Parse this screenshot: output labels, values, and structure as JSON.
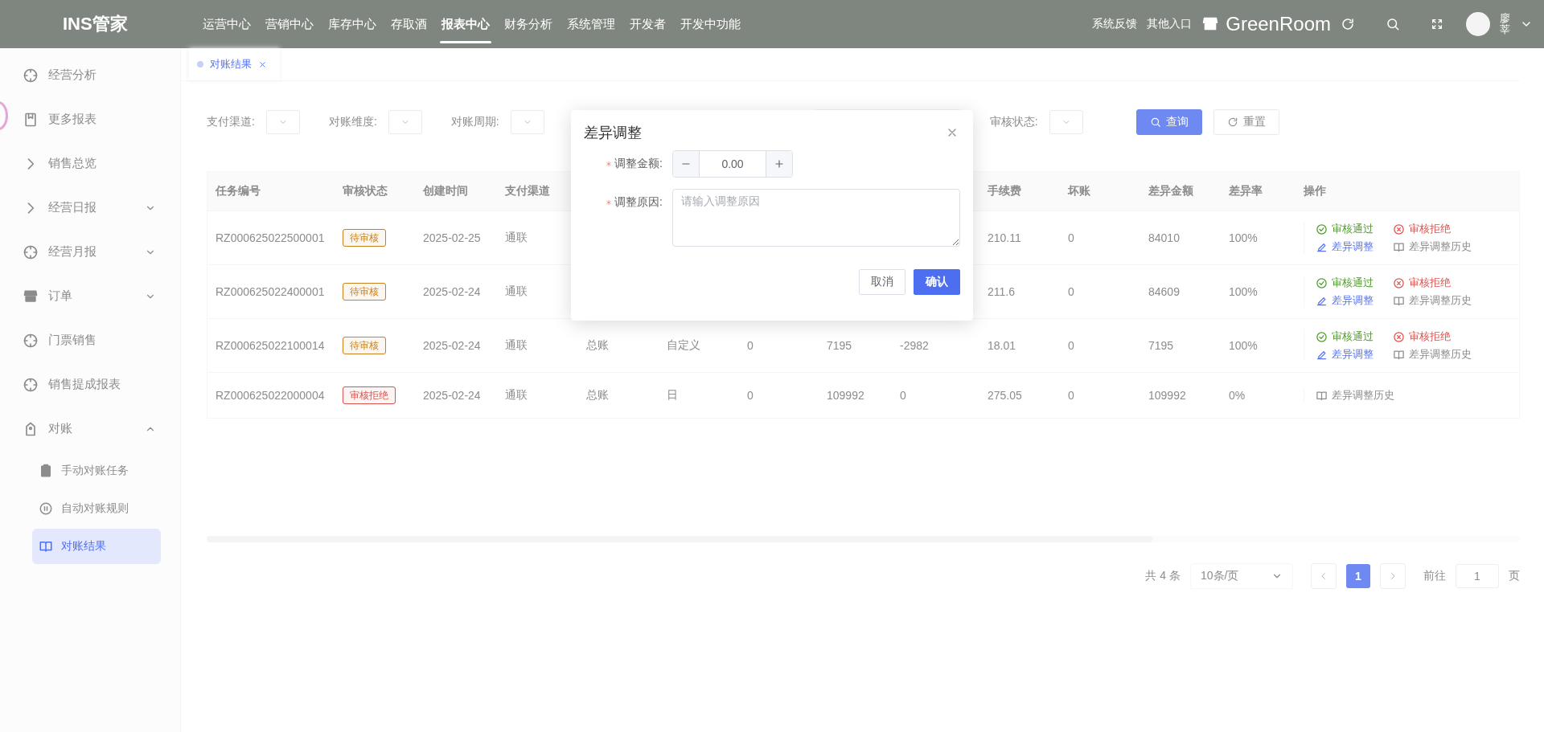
{
  "app": {
    "logo": "INS管家"
  },
  "nav": [
    {
      "label": "运营中心",
      "selected": false
    },
    {
      "label": "营销中心",
      "selected": false
    },
    {
      "label": "库存中心",
      "selected": false
    },
    {
      "label": "存取酒",
      "selected": false
    },
    {
      "label": "报表中心",
      "selected": true
    },
    {
      "label": "财务分析",
      "selected": false
    },
    {
      "label": "系统管理",
      "selected": false
    },
    {
      "label": "开发者",
      "selected": false
    },
    {
      "label": "开发中功能",
      "selected": false
    }
  ],
  "header_links": [
    "系统反馈",
    "其他入口"
  ],
  "store": {
    "name": "GreenRoom"
  },
  "user": {
    "name": "廖莘"
  },
  "sidebar": {
    "items": [
      {
        "label": "经营分析",
        "selected": false
      },
      {
        "label": "更多报表",
        "selected": false
      },
      {
        "label": "销售总览",
        "selected": false
      },
      {
        "label": "经营日报",
        "selected": false,
        "expanded": false
      },
      {
        "label": "经营月报",
        "selected": false,
        "expanded": false
      },
      {
        "label": "订单",
        "selected": false,
        "expanded": false
      },
      {
        "label": "门票销售",
        "selected": false
      },
      {
        "label": "销售提成报表",
        "selected": false
      },
      {
        "label": "对账",
        "selected": false,
        "expanded": true,
        "children": [
          {
            "label": "手动对账任务",
            "selected": false
          },
          {
            "label": "自动对账规则",
            "selected": false
          },
          {
            "label": "对账结果",
            "selected": true
          }
        ]
      }
    ]
  },
  "tabs": [
    {
      "label": "对账结果",
      "selected": true
    }
  ],
  "filters": [
    {
      "kind": "select",
      "label": "支付渠道:"
    },
    {
      "kind": "select",
      "label": "对账维度:"
    },
    {
      "kind": "select",
      "label": "对账周期:"
    },
    {
      "kind": "range"
    },
    {
      "kind": "select",
      "label": "审核状态:"
    }
  ],
  "filter_buttons": [
    {
      "label": "查询",
      "primary": true
    },
    {
      "label": "重置",
      "primary": false
    }
  ],
  "table": {
    "columns": {
      "task_no": "任务编号",
      "status": "审核状态",
      "created_at": "创建时间",
      "channel": "支付渠道",
      "fee": "手续费",
      "bad_debt": "坏账",
      "diff_amount": "差异金额",
      "diff_rate": "差异率",
      "actions": "操作"
    },
    "rows": [
      {
        "task_no": "RZ000625022500001",
        "status": {
          "text": "待审核",
          "color": "#c9821f"
        },
        "created_at": "2025-02-25",
        "channel": "通联",
        "fee": "210.11",
        "bad_debt": "0",
        "diff_amount": "84010",
        "diff_rate": "100%",
        "actions": [
          {
            "kind": "approve",
            "label": "审核通过"
          },
          {
            "kind": "reject",
            "label": "审核拒绝"
          },
          {
            "kind": "adjust",
            "label": "差异调整"
          },
          {
            "kind": "history",
            "label": "差异调整历史"
          }
        ]
      },
      {
        "task_no": "RZ000625022400001",
        "status": {
          "text": "待审核",
          "color": "#c9821f"
        },
        "created_at": "2025-02-24",
        "channel": "通联",
        "fee": "211.6",
        "bad_debt": "0",
        "diff_amount": "84609",
        "diff_rate": "100%",
        "actions": [
          {
            "kind": "approve",
            "label": "审核通过"
          },
          {
            "kind": "reject",
            "label": "审核拒绝"
          },
          {
            "kind": "adjust",
            "label": "差异调整"
          },
          {
            "kind": "history",
            "label": "差异调整历史"
          }
        ]
      },
      {
        "task_no": "RZ000625022100014",
        "status": {
          "text": "待审核",
          "color": "#c9821f"
        },
        "created_at": "2025-02-24",
        "channel": "通联",
        "column_5": "总账",
        "column_6": "自定义",
        "column_7": "0",
        "column_8": "7195",
        "column_9": "-2982",
        "fee": "18.01",
        "bad_debt": "0",
        "diff_amount": "7195",
        "diff_rate": "100%",
        "actions": [
          {
            "kind": "approve",
            "label": "审核通过"
          },
          {
            "kind": "reject",
            "label": "审核拒绝"
          },
          {
            "kind": "adjust",
            "label": "差异调整"
          },
          {
            "kind": "history",
            "label": "差异调整历史"
          }
        ]
      },
      {
        "task_no": "RZ000625022000004",
        "status": {
          "text": "审核拒绝",
          "color": "#d9534f"
        },
        "created_at": "2025-02-24",
        "channel": "通联",
        "column_5": "总账",
        "column_6": "日",
        "column_7": "0",
        "column_8": "109992",
        "column_9": "0",
        "fee": "275.05",
        "bad_debt": "0",
        "diff_amount": "109992",
        "diff_rate": "0%",
        "actions": [
          {
            "kind": "history",
            "label": "差异调整历史"
          }
        ]
      }
    ]
  },
  "pagination": {
    "total": "共 4 条",
    "page_size": "10条/页",
    "pages": [
      {
        "label": "1",
        "selected": true
      }
    ],
    "goto_label": "前往",
    "goto_value": "1",
    "goto_suffix": "页"
  },
  "dialog": {
    "title": "差异调整",
    "fields": [
      {
        "kind": "number",
        "label": "调整金额:",
        "required": true,
        "value": "0.00"
      },
      {
        "kind": "textarea",
        "label": "调整原因:",
        "required": true,
        "placeholder": "请输入调整原因"
      }
    ],
    "buttons": [
      {
        "label": "取消",
        "primary": false
      },
      {
        "label": "确认",
        "primary": true
      }
    ]
  }
}
